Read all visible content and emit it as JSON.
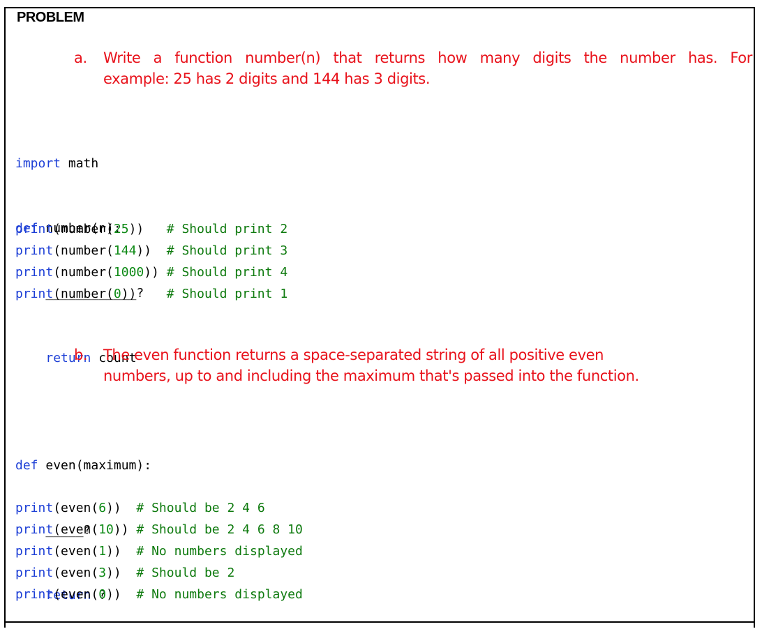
{
  "heading": "PROBLEM",
  "task_a": {
    "marker": "a.",
    "line1": "Write a function number(n) that returns how many digits the number has. For",
    "line2": "example: 25 has 2 digits and 144 has 3 digits."
  },
  "code_a": {
    "l1_kw": "import",
    "l1_rest": " math",
    "l2_kw": "def",
    "l2_rest": " number(n):",
    "l3": "    ____________?",
    "l4_indent": "    ",
    "l4_kw": "return",
    "l4_rest": " count"
  },
  "code_a_tests": [
    {
      "fn": "print",
      "pre": "(number(",
      "num": "25",
      "post": "))   ",
      "comment": "# Should print 2"
    },
    {
      "fn": "print",
      "pre": "(number(",
      "num": "144",
      "post": "))  ",
      "comment": "# Should print 3"
    },
    {
      "fn": "print",
      "pre": "(number(",
      "num": "1000",
      "post": ")) ",
      "comment": "# Should print 4"
    },
    {
      "fn": "print",
      "pre": "(number(",
      "num": "0",
      "post": "))    ",
      "comment": "# Should print 1"
    }
  ],
  "task_b": {
    "marker": "b.",
    "line1": "The even function returns a space-separated string of all positive even",
    "line2": "numbers, up to and including the maximum that's passed into the function."
  },
  "code_b": {
    "l1_kw": "def",
    "l1_rest": " even(maximum):",
    "l2": "    _____?",
    "l3_indent": "    ",
    "l3_kw": "return",
    "l3_rest": " ?"
  },
  "code_b_tests": [
    {
      "fn": "print",
      "pre": "(even(",
      "num": "6",
      "post": "))  ",
      "comment": "# Should be 2 4 6"
    },
    {
      "fn": "print",
      "pre": "(even(",
      "num": "10",
      "post": ")) ",
      "comment": "# Should be 2 4 6 8 10"
    },
    {
      "fn": "print",
      "pre": "(even(",
      "num": "1",
      "post": "))  ",
      "comment": "# No numbers displayed"
    },
    {
      "fn": "print",
      "pre": "(even(",
      "num": "3",
      "post": "))  ",
      "comment": "# Should be 2"
    },
    {
      "fn": "print",
      "pre": "(even(",
      "num": "0",
      "post": "))  ",
      "comment": "# No numbers displayed"
    }
  ],
  "colors": {
    "task_text": "#e8121b",
    "keyword": "#1d3fd6",
    "number": "#0e8a16",
    "comment": "#0e7a0e"
  }
}
